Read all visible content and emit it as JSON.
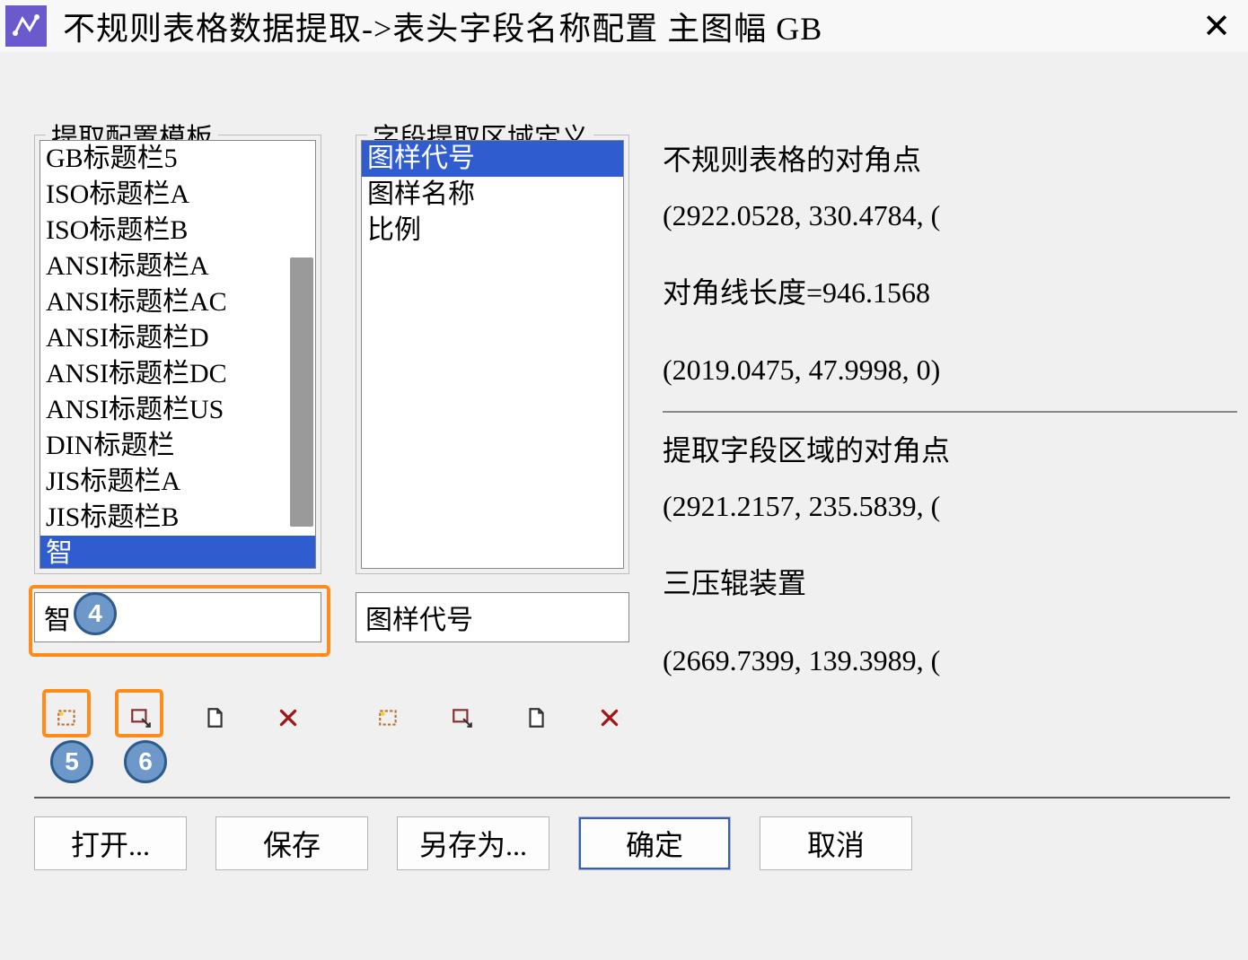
{
  "title": "不规则表格数据提取->表头字段名称配置 主图幅 GB",
  "groups": {
    "templates_label": "提取配置模板",
    "fields_label": "字段提取区域定义"
  },
  "template_list": {
    "items": [
      "GB标题栏5",
      "ISO标题栏A",
      "ISO标题栏B",
      "ANSI标题栏A",
      "ANSI标题栏AC",
      "ANSI标题栏D",
      "ANSI标题栏DC",
      "ANSI标题栏US",
      "DIN标题栏",
      "JIS标题栏A",
      "JIS标题栏B",
      "智"
    ],
    "selected_index": 11,
    "input_value": "智"
  },
  "field_list": {
    "items": [
      "图样代号",
      "图样名称",
      "比例"
    ],
    "selected_index": 0,
    "input_value": "图样代号"
  },
  "right_panel": {
    "corner_label": "不规则表格的对角点",
    "corner_pt1": "(2922.0528,  330.4784,  (",
    "diag_len": "对角线长度=946.1568",
    "corner_pt2": "(2019.0475,  47.9998,  0)",
    "field_corner_label": "提取字段区域的对角点",
    "field_pt1": "(2921.2157,  235.5839,  (",
    "text_found": "三压辊装置",
    "field_pt2": "(2669.7399,  139.3989,  ("
  },
  "callouts": {
    "c4": "4",
    "c5": "5",
    "c6": "6"
  },
  "buttons": {
    "open": "打开...",
    "save": "保存",
    "saveas": "另存为...",
    "ok": "确定",
    "cancel": "取消"
  },
  "tool_icons": {
    "pick_window": "pick-window-icon",
    "pick_region": "pick-region-icon",
    "new_doc": "new-doc-icon",
    "delete": "delete-icon"
  }
}
